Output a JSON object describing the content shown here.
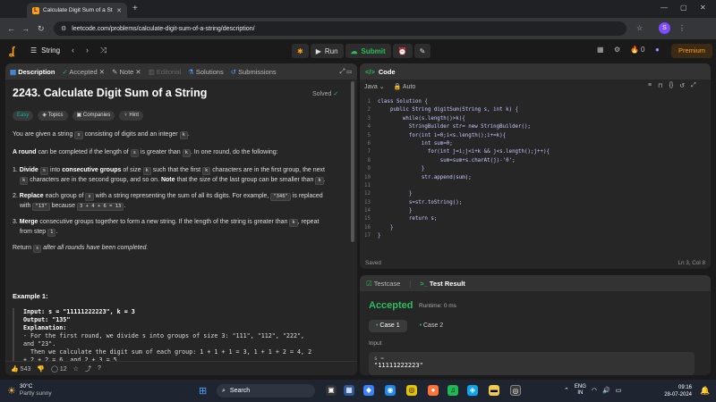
{
  "browser": {
    "tab_title": "Calculate Digit Sum of a String",
    "url": "leetcode.com/problems/calculate-digit-sum-of-a-string/description/",
    "profile_initial": "S"
  },
  "header": {
    "problem_list": "String",
    "run_label": "Run",
    "submit_label": "Submit",
    "streak_count": "0",
    "premium_label": "Premium"
  },
  "left_tabs": [
    "Description",
    "Accepted",
    "Note",
    "Editorial",
    "Solutions",
    "Submissions"
  ],
  "problem": {
    "title": "2243. Calculate Digit Sum of a String",
    "status": "Solved",
    "tags": [
      "Easy",
      "Topics",
      "Companies",
      "Hint"
    ],
    "p1_pre": "You are given a string ",
    "p1_s": "s",
    "p1_mid": " consisting of digits and an integer ",
    "p1_k": "k",
    "p1_post": ".",
    "p2_bold": "A round",
    "p2_mid": " can be completed if the length of ",
    "p2_s": "s",
    "p2_mid2": " is greater than ",
    "p2_k": "k",
    "p2_post": ". In one round, do the following:",
    "step1_a": "1. ",
    "step1_b": "Divide",
    "step1_c": " ",
    "step1_s": "s",
    "step1_d": " into ",
    "step1_e": "consecutive groups",
    "step1_f": " of size ",
    "step1_k": "k",
    "step1_g": " such that the first ",
    "step1_k2": "k",
    "step1_h": " characters are in the first group, the next",
    "step1_k3": "k",
    "step1_i": " characters are in the second group, and so on. ",
    "step1_j": "Note",
    "step1_l": " that the size of the last group can be smaller than ",
    "step1_k4": "k",
    "step1_m": ".",
    "step2_a": "2. ",
    "step2_b": "Replace",
    "step2_c": " each group of ",
    "step2_s": "s",
    "step2_d": " with a string representing the sum of all its digits. For example, ",
    "step2_e": "\"346\"",
    "step2_f": " is replaced",
    "step2_g": "with ",
    "step2_h": "\"13\"",
    "step2_i": " because ",
    "step2_j": "3 + 4 + 6 = 13",
    "step2_k": ".",
    "step3_a": "3. ",
    "step3_b": "Merge",
    "step3_c": " consecutive groups together to form a new string. If the length of the string is greater than ",
    "step3_k": "k",
    "step3_d": ", repeat",
    "step3_e": "from step ",
    "step3_f": "1",
    "step3_g": ".",
    "ret_a": "Return ",
    "ret_s": "s",
    "ret_b": " after all rounds have been completed.",
    "example_title": "Example 1:",
    "ex_input": "Input: s = \"11111222223\", k = 3",
    "ex_output": "Output: \"135\"",
    "ex_expl": "Explanation:",
    "ex_l1": "- For the first round, we divide s into groups of size 3: \"111\", \"112\", \"222\",",
    "ex_l2": "and \"23\".",
    "ex_l3": "  Then we calculate the digit sum of each group: 1 + 1 + 1 = 3, 1 + 1 + 2 = 4, 2",
    "ex_l4": "+ 2 + 2 = 6, and 2 + 3 = 5."
  },
  "left_footer": {
    "likes": "543",
    "comments": "12"
  },
  "code_panel": {
    "title": "Code",
    "language": "Java",
    "mode": "Auto",
    "status_left": "Saved",
    "status_right": "Ln 3, Col 8",
    "lines": [
      "class Solution {",
      "    public String digitSum(String s, int k) {",
      "        while(s.length()>k){",
      "          StringBuilder str= new StringBuilder();",
      "          for(int i=0;i<s.length();i+=k){",
      "              int sum=0;",
      "                for(int j=i;j<i+k && j<s.length();j++){",
      "                    sum=sum+s.charAt(j)-'0';",
      "              }",
      "              str.append(sum);",
      "",
      "          }",
      "          s=str.toString();",
      "          }",
      "          return s;",
      "    }",
      "}"
    ]
  },
  "result_panel": {
    "tab_testcase": "Testcase",
    "tab_result": "Test Result",
    "verdict": "Accepted",
    "runtime": "Runtime: 0 ms",
    "case1": "Case 1",
    "case2": "Case 2",
    "input_label": "Input",
    "input_var": "s =",
    "input_value": "\"11111222223\""
  },
  "taskbar": {
    "temp": "30°C",
    "weather": "Partly sunny",
    "search": "Search",
    "lang1": "ENG",
    "lang2": "IN",
    "time": "09:16",
    "date": "28-07-2024"
  }
}
